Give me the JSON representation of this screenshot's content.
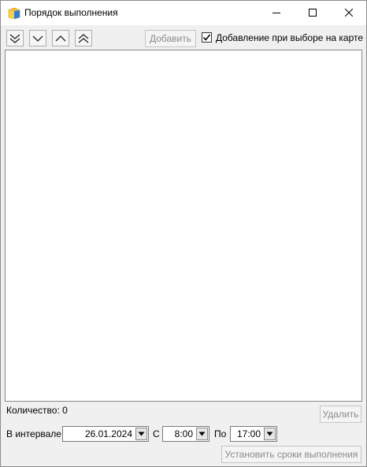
{
  "window": {
    "title": "Порядок выполнения"
  },
  "toolbar": {
    "nav_icons": [
      "double-chevron-down-icon",
      "chevron-down-icon",
      "chevron-up-icon",
      "double-chevron-up-icon"
    ],
    "add_label": "Добавить",
    "add_on_map_label": "Добавление при выборе на карте",
    "add_on_map_checked": true
  },
  "list": {
    "items": []
  },
  "footer": {
    "count_label": "Количество:",
    "count_value": "0",
    "delete_label": "Удалить",
    "interval_label": "В интервале",
    "date_value": "26.01.2024",
    "from_label": "С",
    "from_value": "8:00",
    "to_label": "По",
    "to_value": "17:00",
    "set_deadlines_label": "Установить сроки выполнения"
  },
  "colors": {
    "titlebar": "#ffffff",
    "window_bg": "#f0f0f0",
    "disabled_text": "#8a8a8a",
    "icon_yellow": "#f2c230",
    "icon_blue": "#2f7fd6"
  }
}
